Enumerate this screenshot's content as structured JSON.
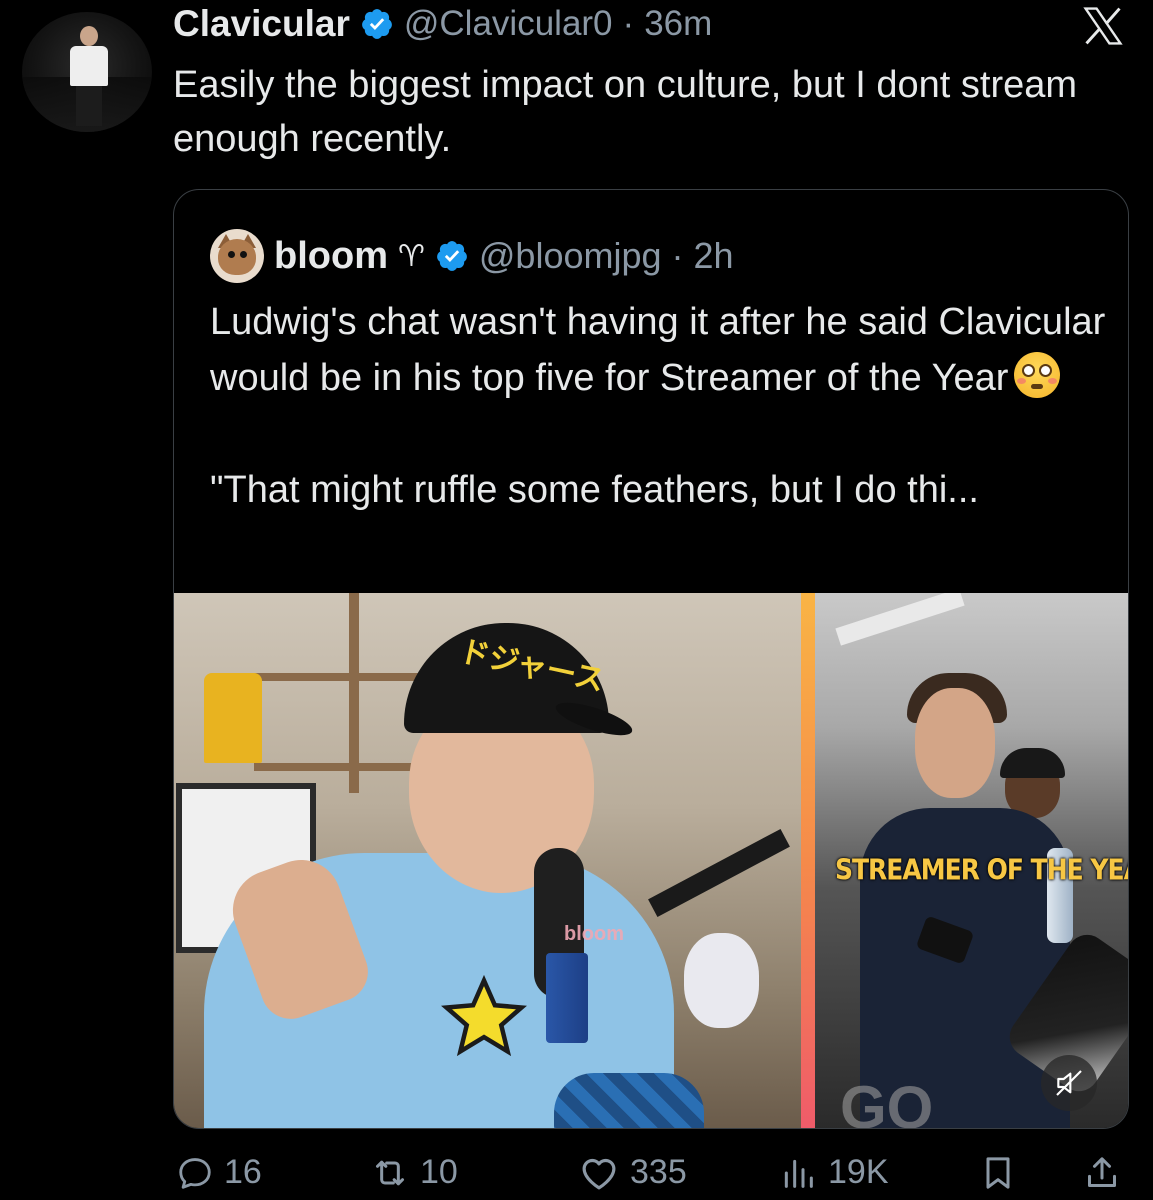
{
  "tweet": {
    "author_name": "Clavicular",
    "author_handle": "@Clavicular0",
    "separator": "·",
    "time": "36m",
    "text": "Easily the biggest impact on culture, but I dont stream enough recently."
  },
  "quote": {
    "author_name": "bloom",
    "name_symbol": "♈",
    "author_handle": "@bloomjpg",
    "separator": "·",
    "time": "2h",
    "text_line1": "Ludwig's chat wasn't having it after he said Clavicular would be in his top five for Streamer of the Year",
    "text_line2": "\"That might ruffle some feathers, but I do thi...",
    "media": {
      "left_cap_text": "ドジャース",
      "left_watermark": "bloom",
      "right_overlay_text": "STREAMER OF THE YEAR",
      "right_watermark": "GQ",
      "divider_colors": [
        "#f9b445",
        "#f58a4a",
        "#ef5b6a"
      ]
    }
  },
  "actions": {
    "replies": "16",
    "reposts": "10",
    "likes": "335",
    "views": "19K"
  },
  "icons": {
    "verified": "verified-badge-icon",
    "x_logo": "x-logo-icon",
    "reply": "reply-icon",
    "repost": "repost-icon",
    "like": "heart-icon",
    "views": "views-chart-icon",
    "bookmark": "bookmark-icon",
    "share": "share-icon",
    "mute": "muted-speaker-icon"
  },
  "colors": {
    "background": "#000000",
    "text_primary": "#e7e9ea",
    "text_secondary": "#8b98a5",
    "verified_blue": "#1d9bf0",
    "border": "#3a3f44",
    "overlay_text_yellow": "#f7c744"
  }
}
